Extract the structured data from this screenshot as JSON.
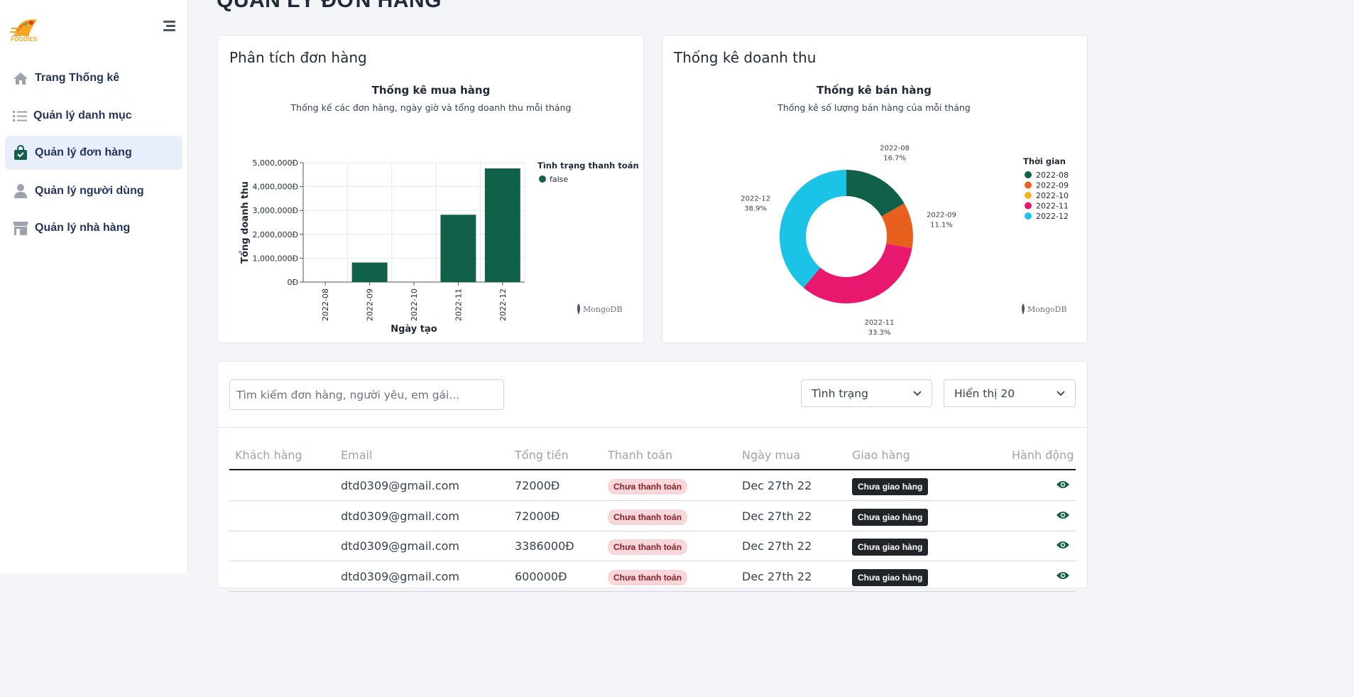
{
  "app": {
    "logo_text": "FOODIES"
  },
  "sidebar": {
    "items": [
      {
        "label": "Trang Thống kê",
        "icon": "home-icon"
      },
      {
        "label": "Quản lý danh mục",
        "icon": "list-icon"
      },
      {
        "label": "Quản lý đơn hàng",
        "icon": "shopping-bag-icon",
        "active": true
      },
      {
        "label": "Quản lý người dùng",
        "icon": "user-icon"
      },
      {
        "label": "Quản lý nhà hàng",
        "icon": "store-icon"
      }
    ]
  },
  "page": {
    "title": "QUẢN LÝ ĐƠN HÀNG"
  },
  "order_analysis": {
    "card_title": "Phân tích đơn hàng",
    "watermark": "MongoDB"
  },
  "revenue_stats": {
    "card_title": "Thống kê doanh thu",
    "watermark": "MongoDB"
  },
  "chart_data": [
    {
      "type": "bar",
      "title": "Thống kê mua hàng",
      "subtitle": "Thống kế các đơn hàng, ngày giờ và tổng doanh thu mỗi tháng",
      "xlabel": "Ngày tạo",
      "ylabel": "Tổng doanh thu",
      "categories": [
        "2022-08",
        "2022-09",
        "2022-10",
        "2022-11",
        "2022-12"
      ],
      "series": [
        {
          "name": "false",
          "values": [
            0,
            820000,
            0,
            2820000,
            4760000
          ]
        }
      ],
      "ylim": [
        0,
        5000000
      ],
      "yticks": [
        "0Đ",
        "1,000,000Đ",
        "2,000,000Đ",
        "3,000,000Đ",
        "4,000,000Đ",
        "5,000,000Đ"
      ],
      "legend_title": "Tình trạng thanh toán",
      "legend_position": "right",
      "grid": true,
      "color": "#11614a"
    },
    {
      "type": "pie",
      "title": "Thống kê bán hàng",
      "subtitle": "Thống kê số lượng bán hàng của mỗi tháng",
      "legend_title": "Thời gian",
      "legend_position": "top-right",
      "categories": [
        "2022-08",
        "2022-09",
        "2022-10",
        "2022-11",
        "2022-12"
      ],
      "values": [
        16.7,
        11.1,
        0,
        33.3,
        38.9
      ],
      "labels": [
        "16.7%",
        "11.1%",
        "",
        "33.3%",
        "38.9%"
      ],
      "colors": [
        "#11614a",
        "#e8601d",
        "#f0b41c",
        "#e8186e",
        "#1bc3e6"
      ]
    }
  ],
  "filters": {
    "search_placeholder": "Tìm kiếm đơn hàng, người yêu, em gái...",
    "status_label": "Tình trạng",
    "page_size_label": "Hiển thị 20"
  },
  "table": {
    "headers": [
      "Khách hàng",
      "Email",
      "Tổng tiền",
      "Thanh toán",
      "Ngày mua",
      "Giao hàng",
      "Hành động"
    ],
    "rows": [
      {
        "customer": "",
        "email": "dtd0309@gmail.com",
        "total": "72000Đ",
        "payment": "Chưa thanh toán",
        "date": "Dec 27th 22",
        "shipping": "Chưa giao hàng"
      },
      {
        "customer": "",
        "email": "dtd0309@gmail.com",
        "total": "72000Đ",
        "payment": "Chưa thanh toán",
        "date": "Dec 27th 22",
        "shipping": "Chưa giao hàng"
      },
      {
        "customer": "",
        "email": "dtd0309@gmail.com",
        "total": "3386000Đ",
        "payment": "Chưa thanh toán",
        "date": "Dec 27th 22",
        "shipping": "Chưa giao hàng"
      },
      {
        "customer": "",
        "email": "dtd0309@gmail.com",
        "total": "600000Đ",
        "payment": "Chưa thanh toán",
        "date": "Dec 27th 22",
        "shipping": "Chưa giao hàng"
      }
    ]
  }
}
